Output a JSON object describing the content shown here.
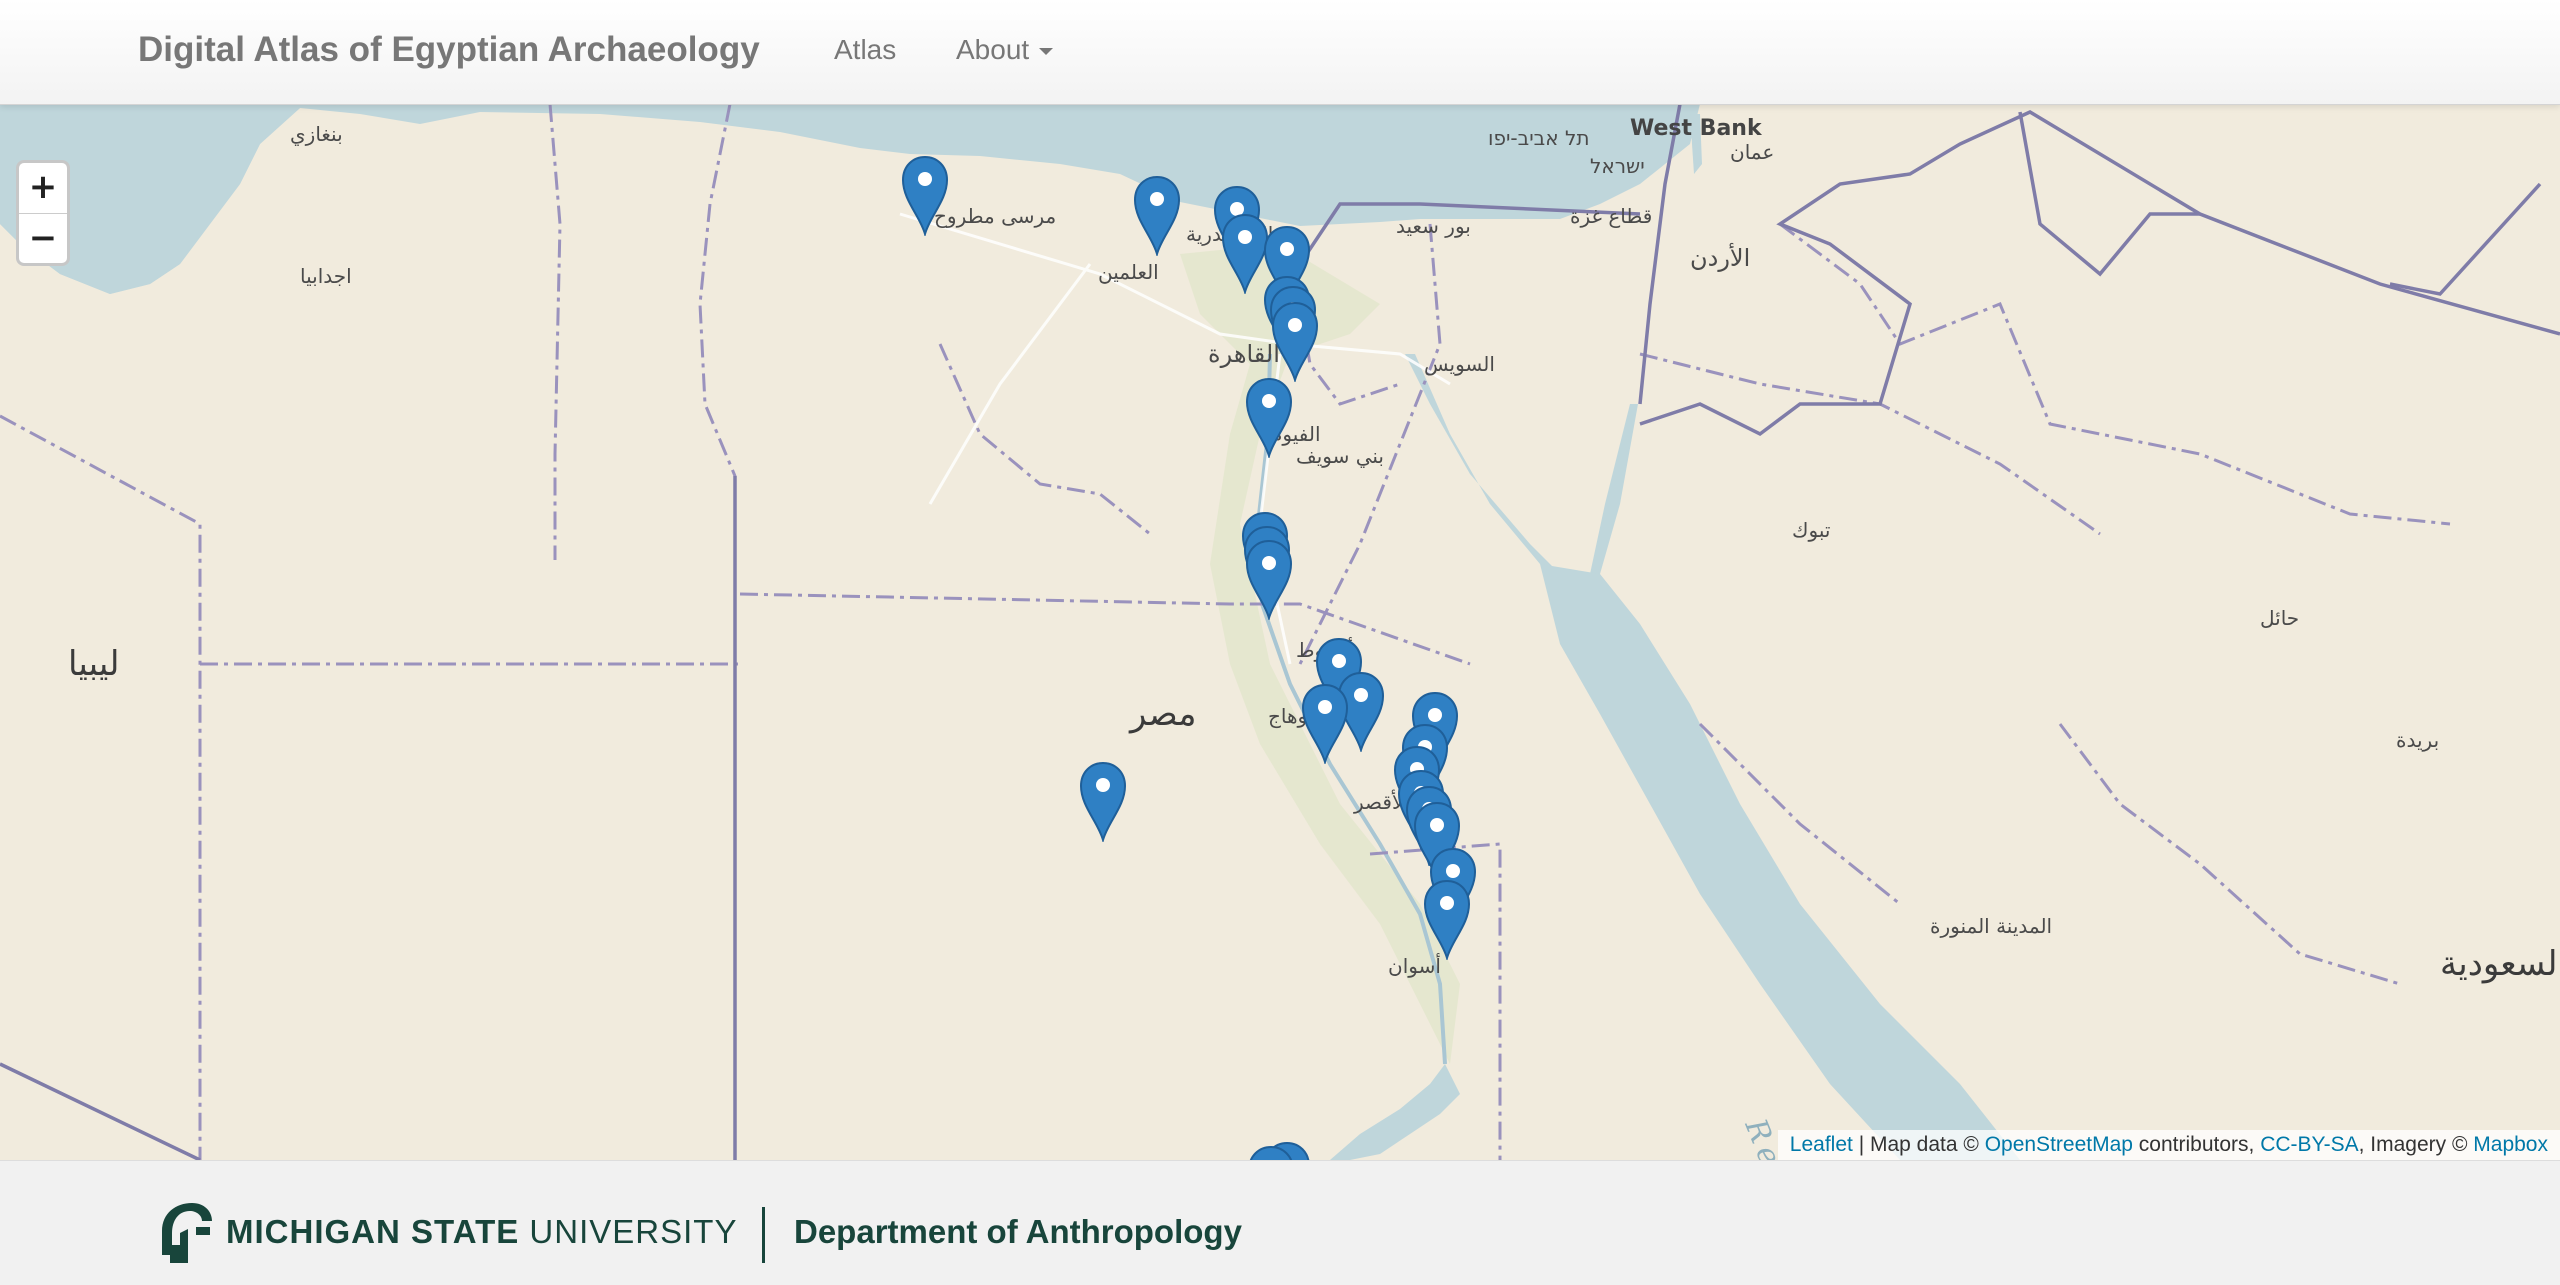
{
  "navbar": {
    "brand": "Digital Atlas of Egyptian Archaeology",
    "links": [
      {
        "label": "Atlas"
      },
      {
        "label": "About"
      }
    ]
  },
  "map": {
    "zoom_in_label": "+",
    "zoom_out_label": "−",
    "marker_color": "#2f80c4",
    "sea_label": "Red Sea",
    "places": {
      "benghazi": "بنغازي",
      "ajdabiya": "اجدابيا",
      "libya": "ليبيا",
      "marsa_matruh": "مرسى مطروح",
      "alamein": "العلمين",
      "alexandria": "الإسكندرية",
      "port_said": "بور سعيد",
      "cairo": "القاهرة",
      "suez": "السويس",
      "fayoum": "الفيوم",
      "beni_suef": "بني سويف",
      "asyut": "أسيوط",
      "sohag": "سوهاج",
      "egypt": "مصر",
      "luxor": "الأقصر",
      "aswan": "أسوان",
      "tel_aviv": "תל אביב-יפו",
      "israel": "ישראל",
      "gaza": "قطاع غزة",
      "west_bank": "West Bank",
      "amman": "عمان",
      "jordan": "الأردن",
      "tabuk": "تبوك",
      "hail": "حائل",
      "buraidah": "بريدة",
      "medina": "المدينة المنورة",
      "saudi": "السعودية"
    },
    "attribution": {
      "leaflet": "Leaflet",
      "sep": " | Map data © ",
      "osm": "OpenStreetMap",
      "contributors": " contributors, ",
      "license": "CC-BY-SA",
      "imagery": ", Imagery © ",
      "mapbox": "Mapbox"
    }
  },
  "footer": {
    "university_bold": "MICHIGAN STATE",
    "university_rest": " UNIVERSITY",
    "department": "Department of Anthropology",
    "brand_color": "#18453b"
  }
}
